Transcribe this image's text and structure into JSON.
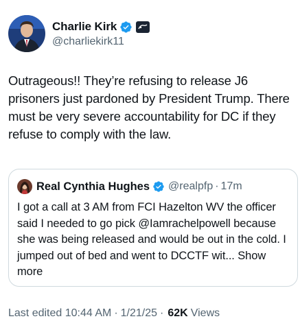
{
  "author": {
    "display_name": "Charlie Kirk",
    "handle": "@charliekirk11",
    "verified_color": "#1d9bf0",
    "avatar_icon": "profile-photo"
  },
  "tweet": {
    "text": "Outrageous!! They’re refusing to release J6 prisoners just pardoned by President Trump. There must be very severe accountability for DC if they refuse to comply with the law."
  },
  "quote": {
    "display_name": "Real Cynthia Hughes",
    "handle": "@realpfp",
    "separator": "·",
    "time": "17m",
    "text": "I got a call at 3 AM from FCI Hazelton WV the officer said I needed to go pick @Iamrachelpowell because she was being released and would be out in the cold. I jumped out of bed and went to DCCTF wit...",
    "show_more": "Show more"
  },
  "meta": {
    "edited_label": "Last edited 10:44 AM",
    "sep1": "·",
    "date": "1/21/25",
    "sep2": "·",
    "views_count": "62K",
    "views_label": "Views"
  }
}
